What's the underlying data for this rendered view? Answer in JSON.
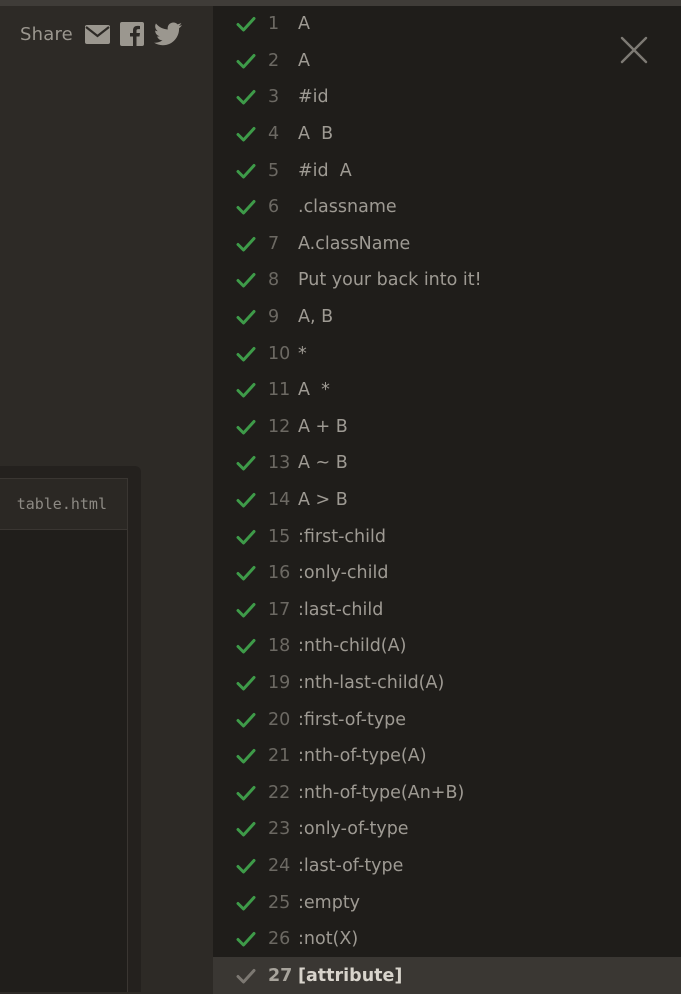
{
  "share": {
    "label": "Share",
    "icons": [
      "email-icon",
      "facebook-icon",
      "twitter-icon"
    ]
  },
  "editor": {
    "tab_label": "table.html"
  },
  "colors": {
    "check_done": "#3e9b49",
    "check_current": "#7c7872",
    "background": "#2d2a26",
    "panel": "#1f1d1a",
    "current_row": "#3a3733"
  },
  "levels": [
    {
      "num": "1",
      "name": "A",
      "completed": true
    },
    {
      "num": "2",
      "name": "A",
      "completed": true
    },
    {
      "num": "3",
      "name": "#id",
      "completed": true
    },
    {
      "num": "4",
      "name": "A  B",
      "completed": true
    },
    {
      "num": "5",
      "name": "#id  A",
      "completed": true
    },
    {
      "num": "6",
      "name": ".classname",
      "completed": true
    },
    {
      "num": "7",
      "name": "A.className",
      "completed": true
    },
    {
      "num": "8",
      "name": "Put your back into it!",
      "completed": true
    },
    {
      "num": "9",
      "name": "A, B",
      "completed": true
    },
    {
      "num": "10",
      "name": "*",
      "completed": true
    },
    {
      "num": "11",
      "name": "A  *",
      "completed": true
    },
    {
      "num": "12",
      "name": "A + B",
      "completed": true
    },
    {
      "num": "13",
      "name": "A ~ B",
      "completed": true
    },
    {
      "num": "14",
      "name": "A > B",
      "completed": true
    },
    {
      "num": "15",
      "name": ":first-child",
      "completed": true
    },
    {
      "num": "16",
      "name": ":only-child",
      "completed": true
    },
    {
      "num": "17",
      "name": ":last-child",
      "completed": true
    },
    {
      "num": "18",
      "name": ":nth-child(A)",
      "completed": true
    },
    {
      "num": "19",
      "name": ":nth-last-child(A)",
      "completed": true
    },
    {
      "num": "20",
      "name": ":first-of-type",
      "completed": true
    },
    {
      "num": "21",
      "name": ":nth-of-type(A)",
      "completed": true
    },
    {
      "num": "22",
      "name": ":nth-of-type(An+B)",
      "completed": true
    },
    {
      "num": "23",
      "name": ":only-of-type",
      "completed": true
    },
    {
      "num": "24",
      "name": ":last-of-type",
      "completed": true
    },
    {
      "num": "25",
      "name": ":empty",
      "completed": true
    },
    {
      "num": "26",
      "name": ":not(X)",
      "completed": true
    },
    {
      "num": "27",
      "name": "[attribute]",
      "completed": false,
      "current": true
    }
  ]
}
